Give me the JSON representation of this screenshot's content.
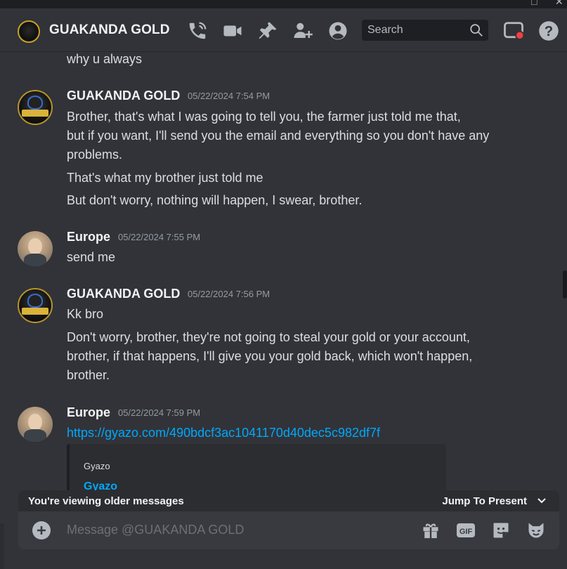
{
  "window": {
    "maximize_glyph": "□",
    "close_glyph": "✕"
  },
  "header": {
    "title": "GUAKANDA GOLD",
    "search_placeholder": "Search",
    "icons": [
      "phone-call-icon",
      "video-icon",
      "pin-icon",
      "add-member-icon",
      "profile-icon",
      "search-icon",
      "inbox-icon",
      "help-icon"
    ]
  },
  "messages": {
    "continuation_top": "why u always",
    "groups": [
      {
        "author": "GUAKANDA GOLD",
        "timestamp": "05/22/2024 7:54 PM",
        "lines": [
          "Brother, that's what I was going to tell you, the farmer just told me that,",
          "but if you want, I'll send you the email and everything so you don't have any",
          "problems.",
          "That's what my brother just told me",
          "But don't worry, nothing will happen, I swear, brother."
        ]
      },
      {
        "author": "Europe",
        "timestamp": "05/22/2024 7:55 PM",
        "lines": [
          "send me"
        ]
      },
      {
        "author": "GUAKANDA GOLD",
        "timestamp": "05/22/2024 7:56 PM",
        "lines": [
          "Kk bro",
          "Don't worry, brother, they're not going to steal your gold or your account,",
          "brother, if that happens, I'll give you your gold back, which won't happen,",
          "brother."
        ]
      },
      {
        "author": "Europe",
        "timestamp": "05/22/2024 7:59 PM",
        "link": "https://gyazo.com/490bdcf3ac1041170d40dec5c982df7f",
        "embed": {
          "provider": "Gyazo",
          "title": "Gyazo"
        }
      }
    ]
  },
  "older_bar": {
    "label": "You're viewing older messages",
    "jump_label": "Jump To Present"
  },
  "composer": {
    "placeholder": "Message @GUAKANDA GOLD",
    "gif_label": "GIF"
  },
  "colors": {
    "background": "#313338",
    "link": "#00a8fc",
    "inbox_dot": "#f23f43"
  }
}
